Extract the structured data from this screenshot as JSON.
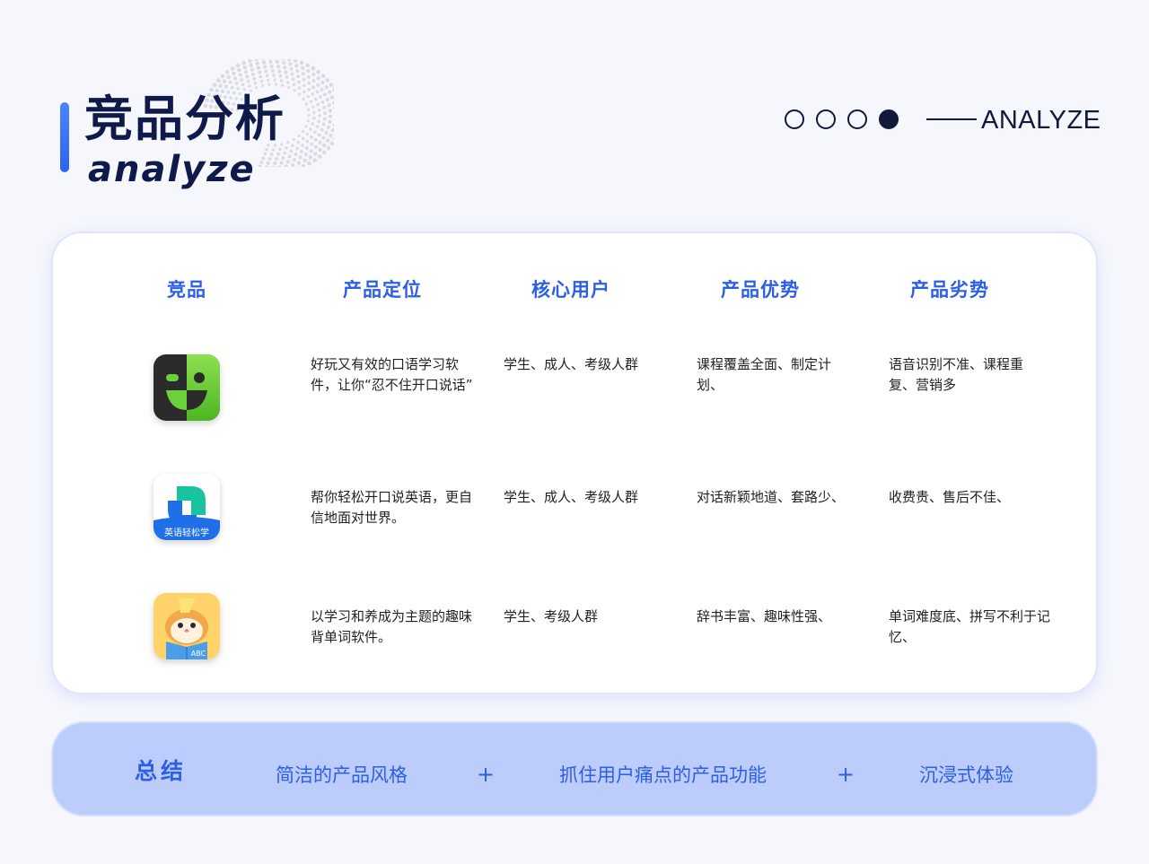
{
  "header": {
    "title_cn": "竞品分析",
    "title_en": "analyze",
    "step_label": "ANALYZE",
    "steps_total": 4,
    "steps_active": 4
  },
  "table": {
    "headers": [
      "竞品",
      "产品定位",
      "核心用户",
      "产品优势",
      "产品劣势"
    ],
    "rows": [
      {
        "icon": "smiley-app-icon",
        "positioning": "好玩又有效的口语学习软件，让你“忍不住开口说话”",
        "users": "学生、成人、考级人群",
        "strengths": "课程覆盖全面、制定计划、",
        "weaknesses": "语音识别不准、课程重复、营销多"
      },
      {
        "icon": "yingyu-qingsongxue-icon",
        "icon_label": "英语轻松学",
        "positioning": "帮你轻松开口说英语，更自信地面对世界。",
        "users": "学生、成人、考级人群",
        "strengths": "对话新颖地道、套路少、",
        "weaknesses": "收费贵、售后不佳、"
      },
      {
        "icon": "hamster-book-icon",
        "icon_label": "ABC",
        "positioning": "以学习和养成为主题的趣味背单词软件。",
        "users": "学生、考级人群",
        "strengths": "辞书丰富、趣味性强、",
        "weaknesses": "单词难度底、拼写不利于记忆、"
      }
    ]
  },
  "summary": {
    "title": "总结",
    "items": [
      "简洁的产品风格",
      "抓住用户痛点的产品功能",
      "沉浸式体验"
    ],
    "separator": "+"
  },
  "colors": {
    "accent": "#2d5fe6",
    "dark": "#0f1a4a",
    "summary_bg": "#bccdfb"
  }
}
